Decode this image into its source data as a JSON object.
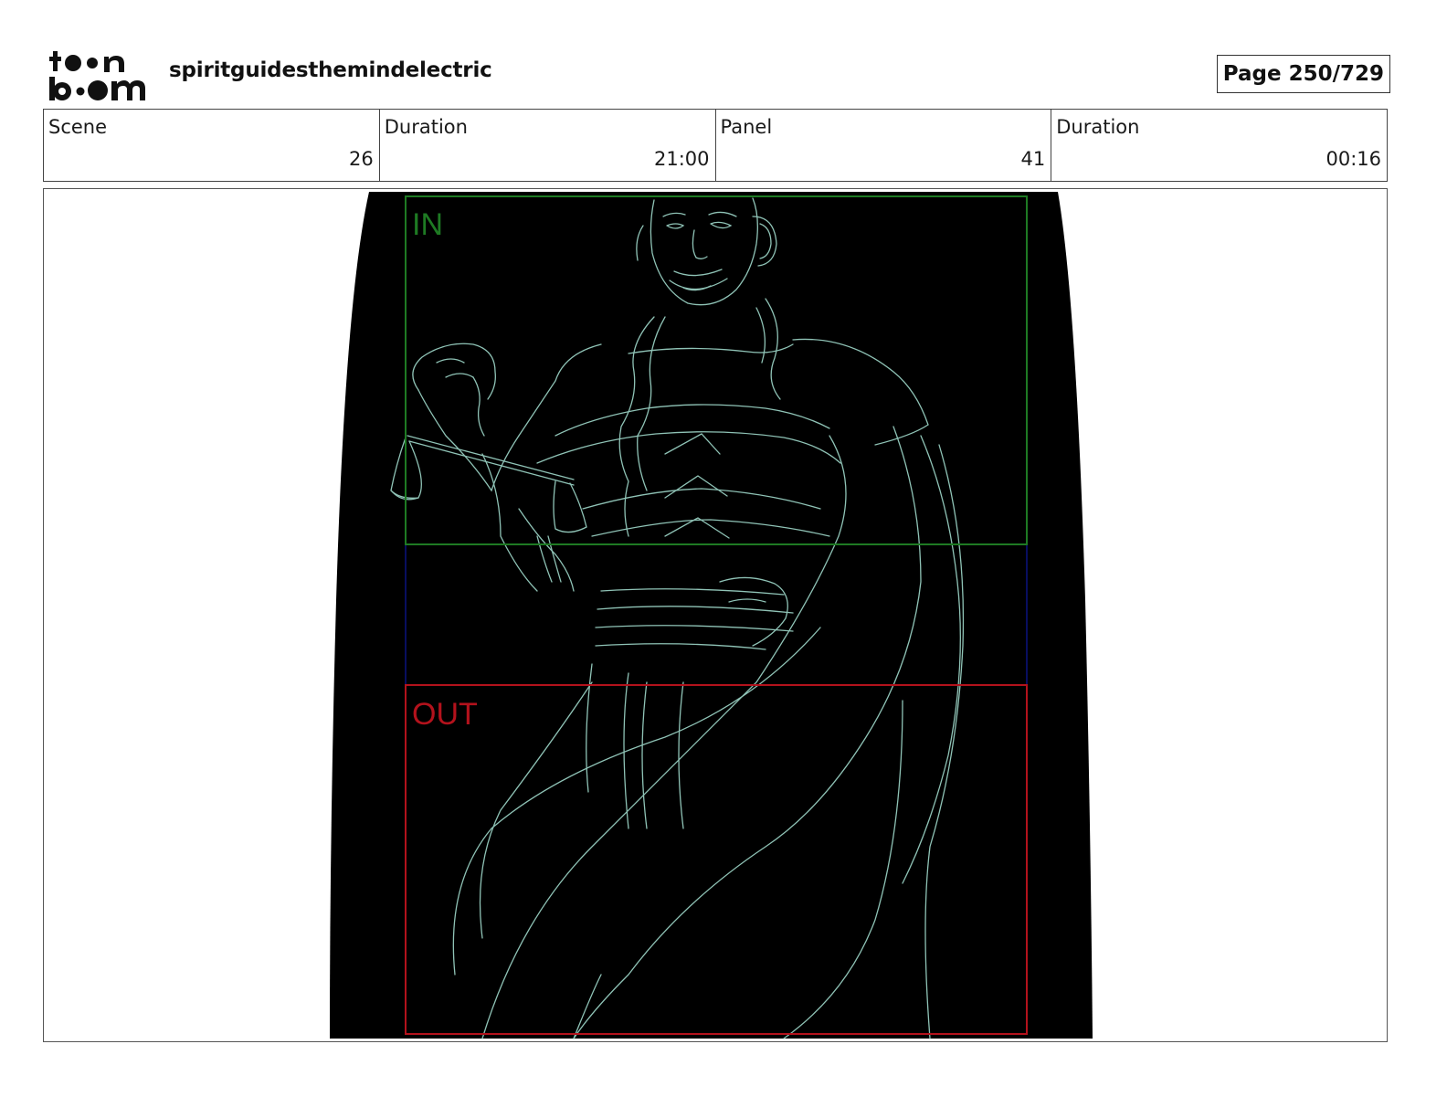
{
  "header": {
    "logo_text": "toon boom",
    "project_title": "spiritguidesthemindelectric",
    "page_label": "Page 250/729"
  },
  "info": {
    "scene_label": "Scene",
    "scene_value": "26",
    "scene_duration_label": "Duration",
    "scene_duration_value": "21:00",
    "panel_label": "Panel",
    "panel_value": "41",
    "panel_duration_label": "Duration",
    "panel_duration_value": "00:16"
  },
  "panel": {
    "in_label": "IN",
    "out_label": "OUT",
    "colors": {
      "in_frame": "#1e7a23",
      "out_frame": "#b3121c",
      "mid_frame": "#0a1280",
      "line_art": "#8fc3b6",
      "background": "#000000"
    }
  }
}
